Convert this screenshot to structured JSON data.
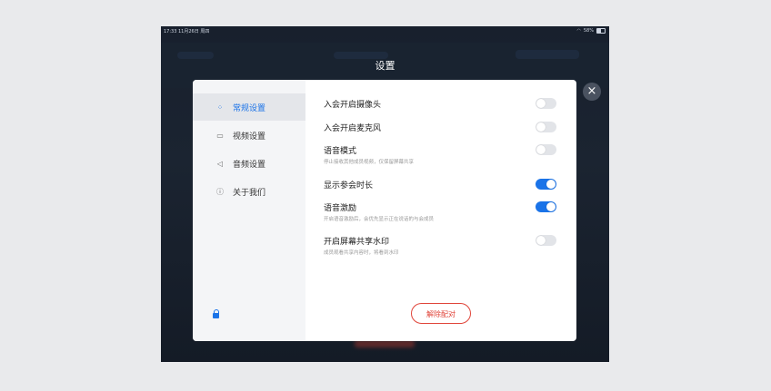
{
  "status_bar": {
    "time": "17:33  11月26日 周四",
    "wifi": "wifi-icon",
    "battery_text": "58%"
  },
  "title": "设置",
  "close_icon": "close-icon",
  "sidebar": {
    "items": [
      {
        "label": "常规设置",
        "icon": "grid-icon",
        "glyph": "⁘",
        "active": true
      },
      {
        "label": "视频设置",
        "icon": "camera-icon",
        "glyph": "▭",
        "active": false
      },
      {
        "label": "音频设置",
        "icon": "speaker-icon",
        "glyph": "◁",
        "active": false
      },
      {
        "label": "关于我们",
        "icon": "info-icon",
        "glyph": "ⓘ",
        "active": false
      }
    ],
    "lock_icon": "lock-icon"
  },
  "settings": [
    {
      "label": "入会开启摄像头",
      "desc": "",
      "on": false
    },
    {
      "label": "入会开启麦克风",
      "desc": "",
      "on": false
    },
    {
      "label": "语音模式",
      "desc": "停止接收其他成员视频，仅保留屏幕共享",
      "on": false
    },
    {
      "label": "显示参会时长",
      "desc": "",
      "on": true
    },
    {
      "label": "语音激励",
      "desc": "开启语音激励后，会优先显示正在说话的与会成员",
      "on": true
    },
    {
      "label": "开启屏幕共享水印",
      "desc": "成员观看共享内容时，将看到水印",
      "on": false
    }
  ],
  "unpair_button": "解除配对",
  "colors": {
    "accent": "#1a73e8",
    "danger": "#e0453a",
    "toggle_off": "#e2e4e8"
  }
}
